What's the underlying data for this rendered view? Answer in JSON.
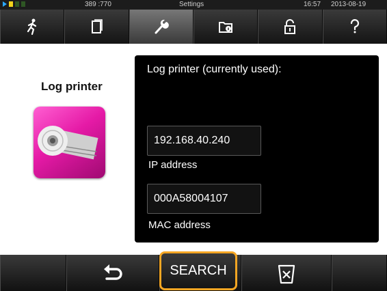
{
  "status_bar": {
    "position": "389 :770",
    "title": "Settings",
    "time": "16:57",
    "date": "2013-08-19"
  },
  "tabs": [
    {
      "icon": "person-running-icon",
      "active": false
    },
    {
      "icon": "document-icon",
      "active": false
    },
    {
      "icon": "wrench-icon",
      "active": true
    },
    {
      "icon": "info-folder-icon",
      "active": false
    },
    {
      "icon": "lock-icon",
      "active": false
    },
    {
      "icon": "question-icon",
      "active": false
    }
  ],
  "left": {
    "title": "Log printer",
    "icon": "log-printer-icon"
  },
  "panel": {
    "heading": "Log printer (currently used):",
    "ip_value": "192.168.40.240",
    "ip_label": "IP address",
    "mac_value": "000A58004107",
    "mac_label": "MAC address"
  },
  "bottom": {
    "back_icon": "back-arrow-icon",
    "search_label": "SEARCH",
    "delete_icon": "trash-icon"
  },
  "colors": {
    "accent_highlight": "#f5a623",
    "tile_magenta": "#e51aa6",
    "active_tab": "#6a6a6a"
  }
}
